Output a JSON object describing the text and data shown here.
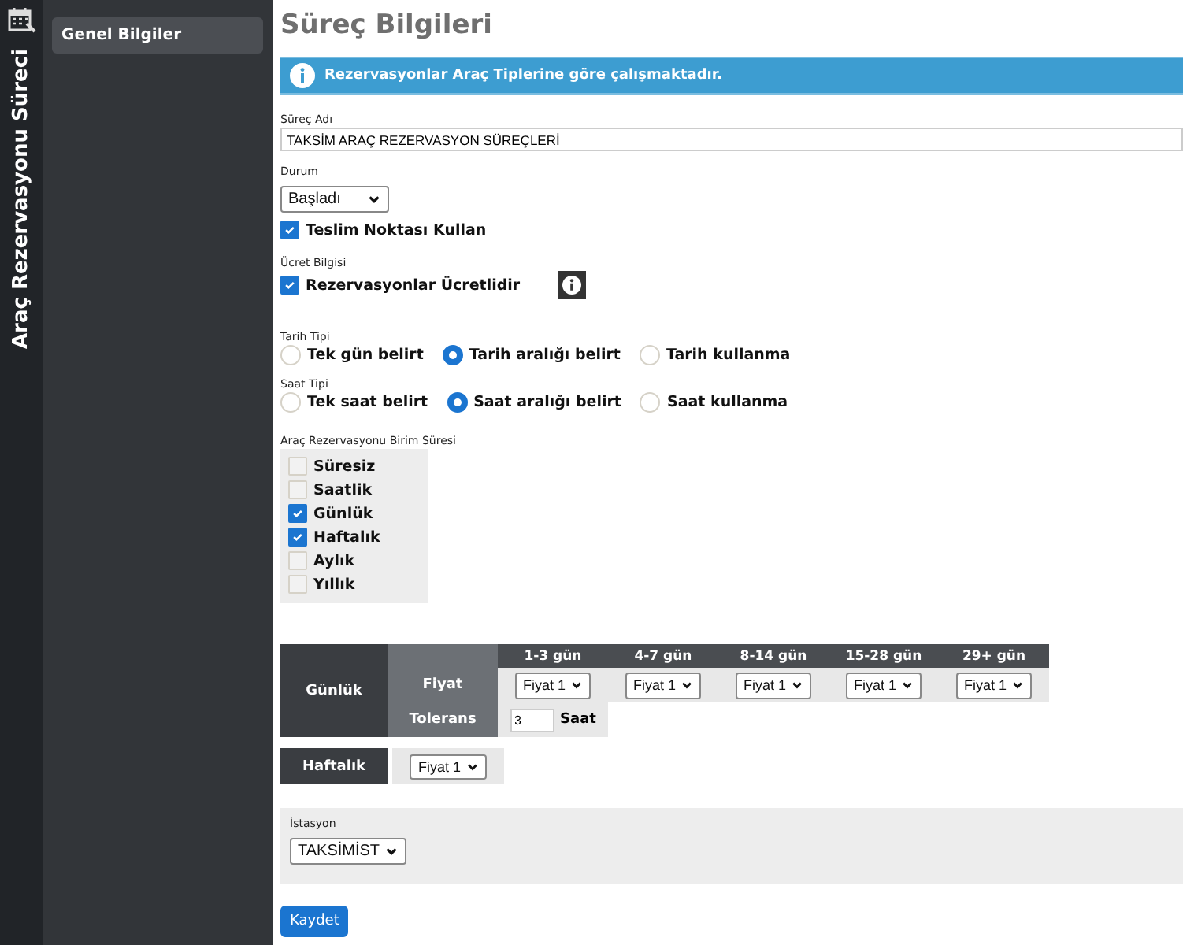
{
  "rail": {
    "title": "Araç Rezervasyonu Süreci"
  },
  "sidebar": {
    "items": [
      {
        "label": "Genel Bilgiler",
        "selected": true
      }
    ]
  },
  "page_title": "Süreç Bilgileri",
  "info_banner": "Rezervasyonlar Araç Tiplerine göre çalışmaktadır.",
  "process_name": {
    "label": "Süreç Adı",
    "value": "TAKSİM ARAÇ REZERVASYON SÜREÇLERİ"
  },
  "status": {
    "label": "Durum",
    "value": "Başladı"
  },
  "delivery_point": {
    "label": "Teslim Noktası Kullan",
    "checked": true
  },
  "fee": {
    "label": "Ücret Bilgisi",
    "option": {
      "label": "Rezervasyonlar Ücretlidir",
      "checked": true
    }
  },
  "date_type": {
    "label": "Tarih Tipi",
    "options": [
      {
        "label": "Tek gün belirt",
        "selected": false
      },
      {
        "label": "Tarih aralığı belirt",
        "selected": true
      },
      {
        "label": "Tarih kullanma",
        "selected": false
      }
    ]
  },
  "time_type": {
    "label": "Saat Tipi",
    "options": [
      {
        "label": "Tek saat belirt",
        "selected": false
      },
      {
        "label": "Saat aralığı belirt",
        "selected": true
      },
      {
        "label": "Saat kullanma",
        "selected": false
      }
    ]
  },
  "unit_duration": {
    "label": "Araç Rezervasyonu Birim Süresi",
    "options": [
      {
        "label": "Süresiz",
        "checked": false
      },
      {
        "label": "Saatlik",
        "checked": false
      },
      {
        "label": "Günlük",
        "checked": true
      },
      {
        "label": "Haftalık",
        "checked": true
      },
      {
        "label": "Aylık",
        "checked": false
      },
      {
        "label": "Yıllık",
        "checked": false
      }
    ]
  },
  "daily": {
    "label": "Günlük",
    "price_label": "Fiyat",
    "tolerance_label": "Tolerans",
    "columns": [
      {
        "heading": "1-3 gün",
        "price": "Fiyat 1"
      },
      {
        "heading": "4-7 gün",
        "price": "Fiyat 1"
      },
      {
        "heading": "8-14 gün",
        "price": "Fiyat 1"
      },
      {
        "heading": "15-28 gün",
        "price": "Fiyat 1"
      },
      {
        "heading": "29+ gün",
        "price": "Fiyat 1"
      }
    ],
    "tolerance": {
      "value": "3",
      "unit": "Saat"
    }
  },
  "weekly": {
    "label": "Haftalık",
    "price": "Fiyat 1"
  },
  "station": {
    "label": "İstasyon",
    "value": "TAKSİMİST"
  },
  "save_button": "Kaydet"
}
